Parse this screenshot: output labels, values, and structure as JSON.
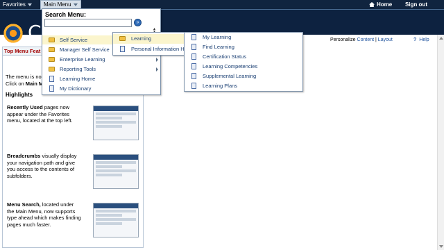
{
  "topnav": {
    "favorites": "Favorites",
    "main_menu": "Main Menu",
    "home": "Home",
    "sign_out": "Sign out"
  },
  "personalize": {
    "label": "Personalize",
    "content": "Content",
    "sep": "|",
    "layout": "Layout",
    "help": "Help"
  },
  "pagelet": {
    "title": "Top Menu Feat",
    "line1": "The menu is no",
    "line2_a": "Click on ",
    "line2_b": "Main M",
    "highlights": "Highlights",
    "features": [
      {
        "bold": "Recently Used",
        "text": " pages now appear under the Favorites menu, located at the top left."
      },
      {
        "bold": "Breadcrumbs",
        "text": " visually display your navigation path and give you access to the contents of subfolders."
      },
      {
        "bold": "Menu Search,",
        "text": " located under the Main Menu, now supports type ahead which makes finding pages much faster."
      }
    ]
  },
  "search": {
    "label": "Search Menu:",
    "value": "",
    "go": "»"
  },
  "menu": {
    "items": [
      {
        "label": "Self Service",
        "icon": "folder",
        "active": true
      },
      {
        "label": "Manager Self Service",
        "icon": "folder",
        "active": false
      },
      {
        "label": "Enterprise Learning",
        "icon": "folder",
        "active": false,
        "arrow": true
      },
      {
        "label": "Reporting Tools",
        "icon": "folder",
        "active": false,
        "arrow": true
      },
      {
        "label": "Learning Home",
        "icon": "doc",
        "active": false
      },
      {
        "label": "My Dictionary",
        "icon": "doc",
        "active": false
      }
    ]
  },
  "submenu1": {
    "items": [
      {
        "label": "Learning",
        "icon": "folder"
      },
      {
        "label": "Personal Information Ha",
        "icon": "doc"
      }
    ]
  },
  "submenu2": {
    "items": [
      {
        "label": "My Learning"
      },
      {
        "label": "Find Learning"
      },
      {
        "label": "Certification Status"
      },
      {
        "label": "Learning Competencies"
      },
      {
        "label": "Supplemental Learning"
      },
      {
        "label": "Learning Plans"
      }
    ]
  },
  "thumbs": {
    "brand": "ORACLE"
  }
}
